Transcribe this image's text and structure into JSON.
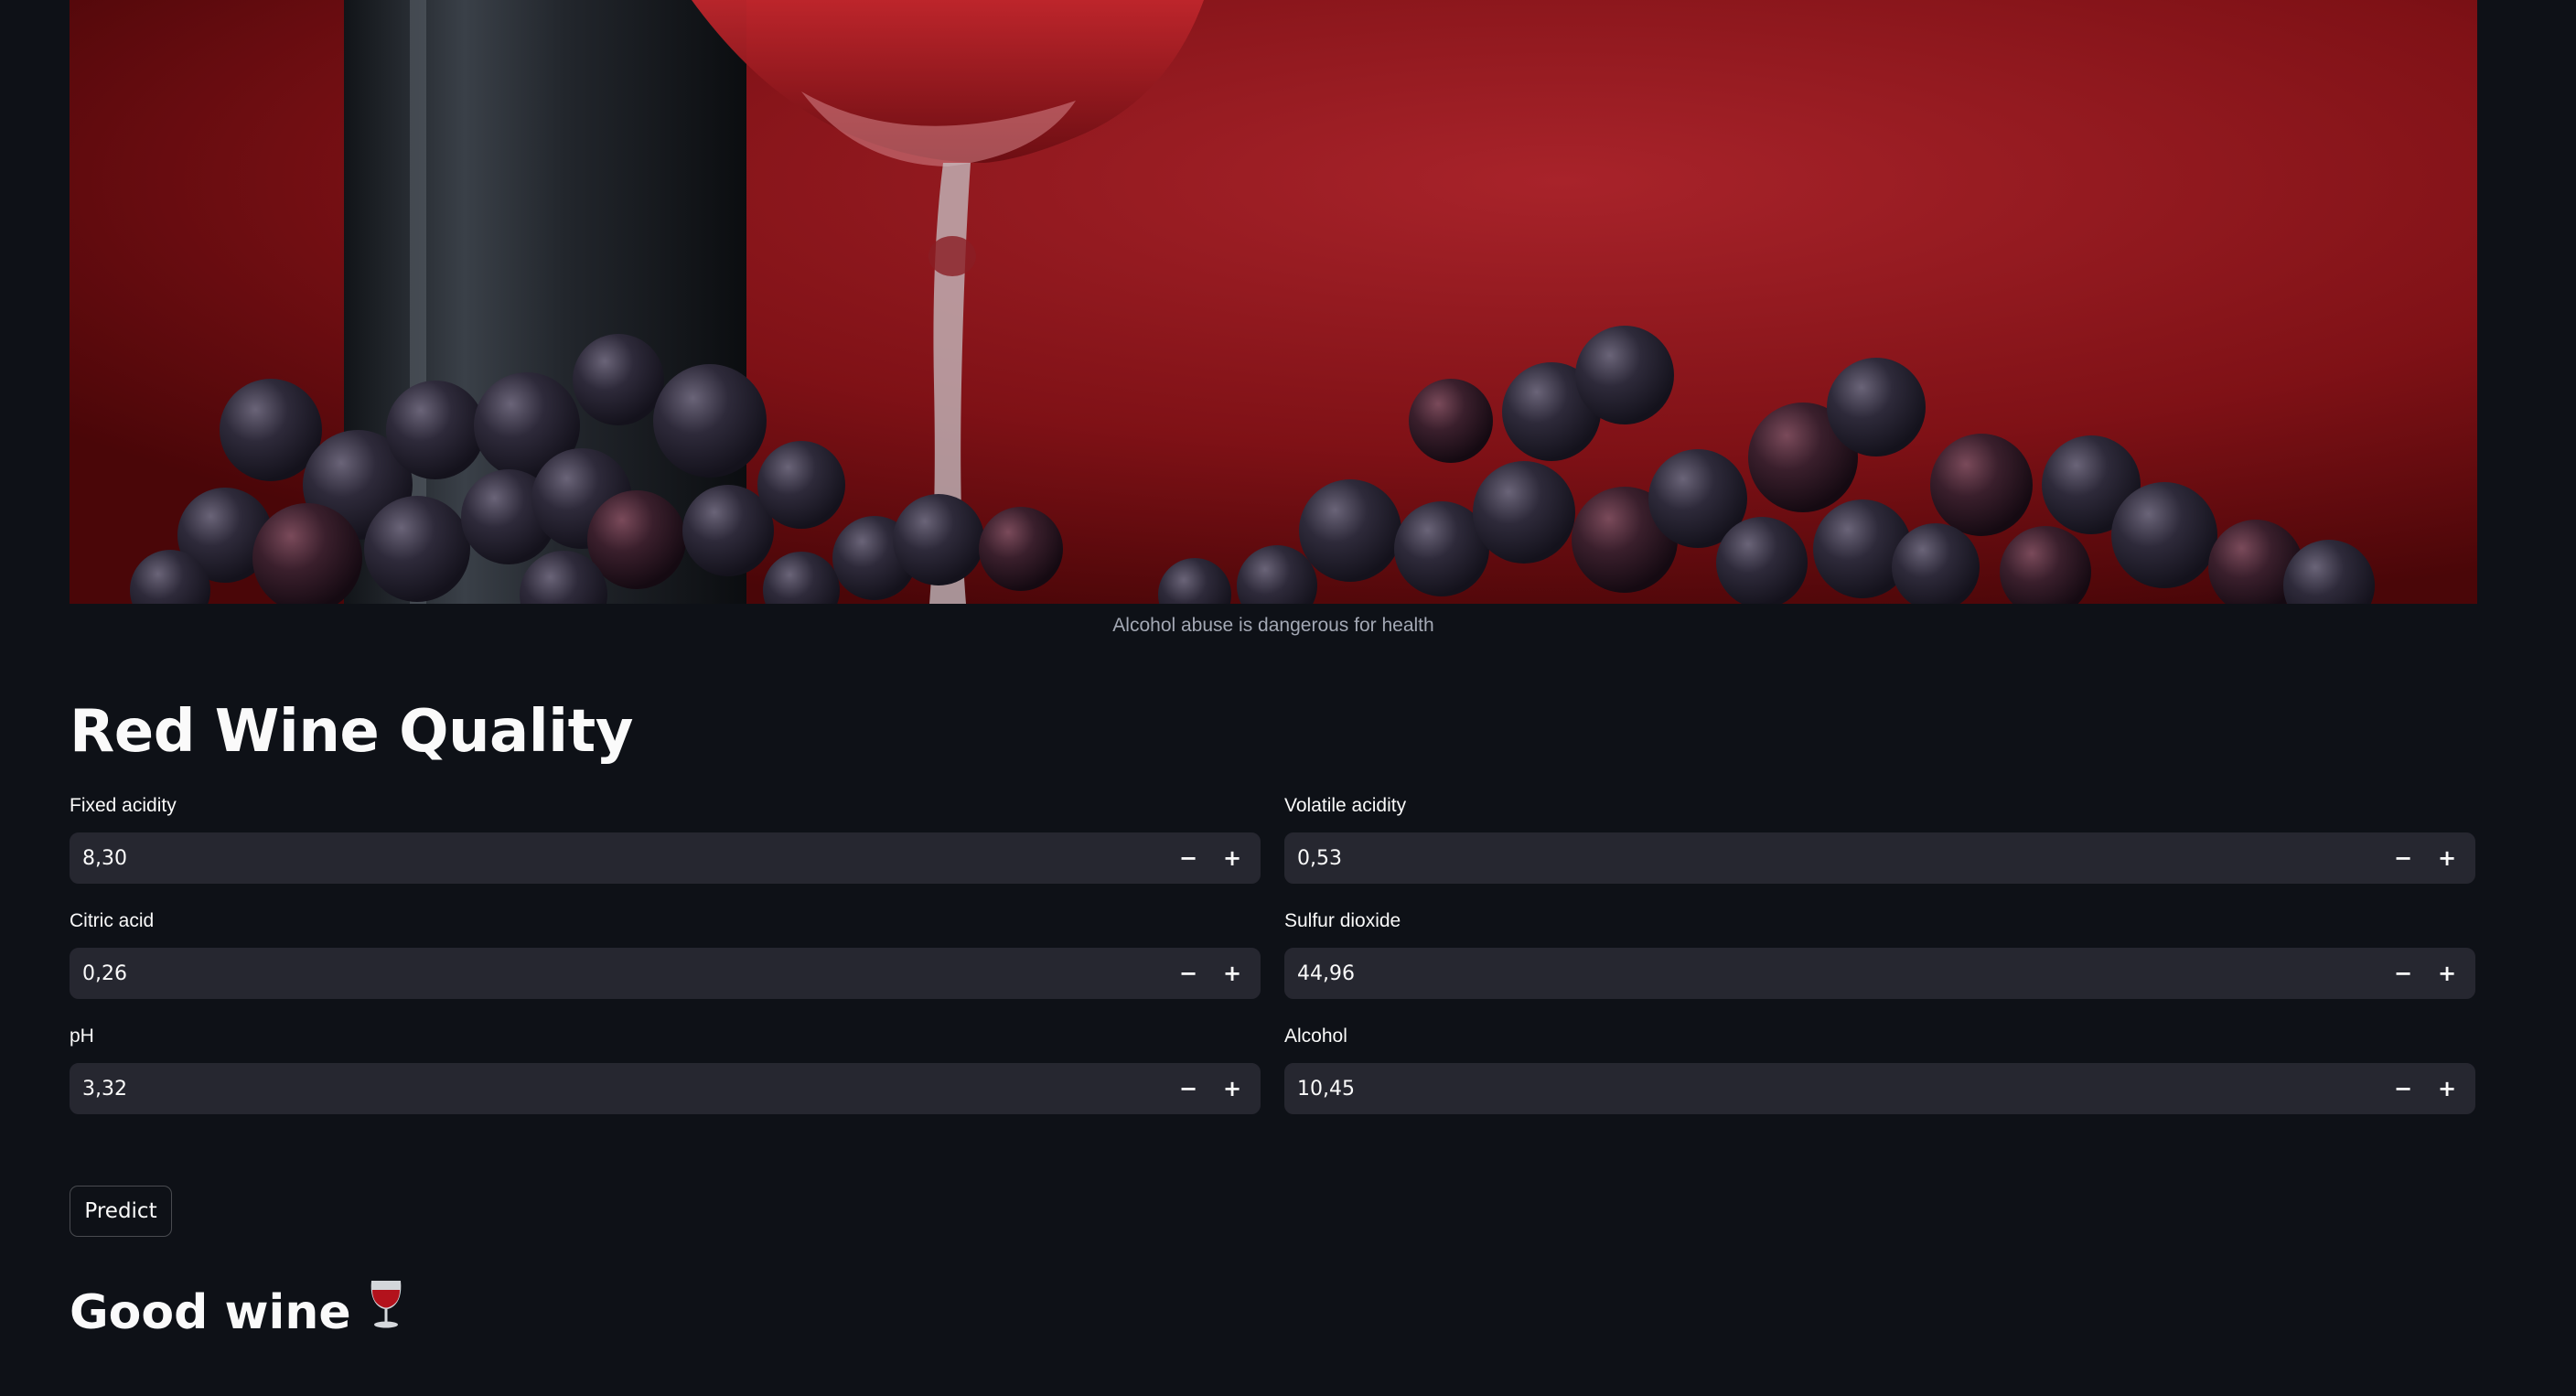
{
  "hero": {
    "caption": "Alcohol abuse is dangerous for health"
  },
  "title": "Red Wine Quality",
  "fields": [
    {
      "label": "Fixed acidity",
      "value": "8,30"
    },
    {
      "label": "Volatile acidity",
      "value": "0,53"
    },
    {
      "label": "Citric acid",
      "value": "0,26"
    },
    {
      "label": "Sulfur dioxide",
      "value": "44,96"
    },
    {
      "label": "pH",
      "value": "3,32"
    },
    {
      "label": "Alcohol",
      "value": "10,45"
    }
  ],
  "stepper": {
    "minus": "−",
    "plus": "+"
  },
  "predict_label": "Predict",
  "result": {
    "text": "Good wine",
    "icon": "wine-glass-icon"
  },
  "colors": {
    "background": "#0e1117",
    "input_bg": "#262730",
    "text": "#fafafa",
    "wine_red": "#9b1c22"
  }
}
